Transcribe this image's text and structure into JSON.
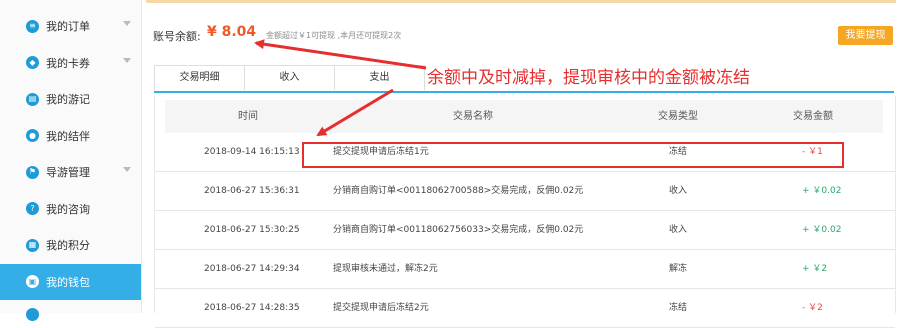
{
  "sidebar": {
    "items": [
      {
        "label": "我的订单",
        "icon": "document-icon",
        "glyph": "≡",
        "has_caret": true,
        "active": false
      },
      {
        "label": "我的卡券",
        "icon": "tag-icon",
        "glyph": "◆",
        "has_caret": true,
        "active": false
      },
      {
        "label": "我的游记",
        "icon": "notebook-icon",
        "glyph": "▤",
        "has_caret": false,
        "active": false
      },
      {
        "label": "我的结伴",
        "icon": "people-icon",
        "glyph": "●",
        "has_caret": false,
        "active": false
      },
      {
        "label": "导游管理",
        "icon": "flag-icon",
        "glyph": "⚑",
        "has_caret": true,
        "active": false
      },
      {
        "label": "我的咨询",
        "icon": "question-icon",
        "glyph": "?",
        "has_caret": false,
        "active": false
      },
      {
        "label": "我的积分",
        "icon": "gift-icon",
        "glyph": "▦",
        "has_caret": false,
        "active": false
      },
      {
        "label": "我的钱包",
        "icon": "wallet-icon",
        "glyph": "▣",
        "has_caret": false,
        "active": true
      }
    ]
  },
  "account": {
    "balance_label": "账号余额:",
    "balance_value": "¥ 8.04",
    "note": "金额超过￥1可提现 ,本月还可提现2次",
    "withdraw_button": "我要提现"
  },
  "tabs": [
    {
      "label": "交易明细",
      "active": true
    },
    {
      "label": "收入",
      "active": false
    },
    {
      "label": "支出",
      "active": false
    }
  ],
  "table": {
    "headers": [
      "时间",
      "交易名称",
      "交易类型",
      "交易金额"
    ],
    "rows": [
      {
        "time": "2018-09-14 16:15:13",
        "name": "提交提现申请后冻结1元",
        "type": "冻结",
        "amount": "- ￥1",
        "sign": "neg"
      },
      {
        "time": "2018-06-27 15:36:31",
        "name": "分销商自购订单<00118062700588>交易完成，反佣0.02元",
        "type": "收入",
        "amount": "+ ￥0.02",
        "sign": "pos"
      },
      {
        "time": "2018-06-27 15:30:25",
        "name": "分销商自购订单<00118062756033>交易完成，反佣0.02元",
        "type": "收入",
        "amount": "+ ￥0.02",
        "sign": "pos"
      },
      {
        "time": "2018-06-27 14:29:34",
        "name": "提现审核未通过，解冻2元",
        "type": "解冻",
        "amount": "+ ￥2",
        "sign": "pos"
      },
      {
        "time": "2018-06-27 14:28:35",
        "name": "提交提现申请后冻结2元",
        "type": "冻结",
        "amount": "- ￥2",
        "sign": "neg"
      }
    ]
  },
  "annotation": {
    "text": "余额中及时减掉，提现审核中的金额被冻结",
    "color": "#e62e2e"
  }
}
